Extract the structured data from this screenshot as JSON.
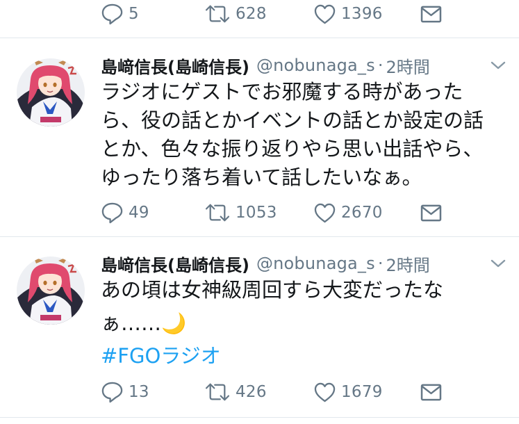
{
  "top_actions": {
    "reply_count": "5",
    "retweet_count": "628",
    "like_count": "1396"
  },
  "tweets": [
    {
      "name": "島﨑信長(島崎信長)",
      "handle": "@nobunaga_s",
      "separator": "·",
      "time": "2時間",
      "lines": [
        "ラジオにゲストでお邪魔する時があった",
        "ら、役の話とかイベントの話とか設定の話",
        "とか、色々な振り返りやら思い出話やら、",
        "ゆったり落ち着いて話したいなぁ。"
      ],
      "reply_count": "49",
      "retweet_count": "1053",
      "like_count": "2670"
    },
    {
      "name": "島﨑信長(島崎信長)",
      "handle": "@nobunaga_s",
      "separator": "·",
      "time": "2時間",
      "lines": [
        "あの頃は女神級周回すら大変だったな",
        "ぁ……"
      ],
      "emoji": "🌙",
      "hashtag": "#FGOラジオ",
      "reply_count": "13",
      "retweet_count": "426",
      "like_count": "1679"
    }
  ],
  "icons": [
    "reply-icon",
    "retweet-icon",
    "like-icon",
    "dm-icon",
    "chevron-down-icon"
  ],
  "colors": {
    "text": "#14171a",
    "secondary": "#657786",
    "hashtag": "#1da1f2",
    "divider": "#e1e8ed"
  }
}
